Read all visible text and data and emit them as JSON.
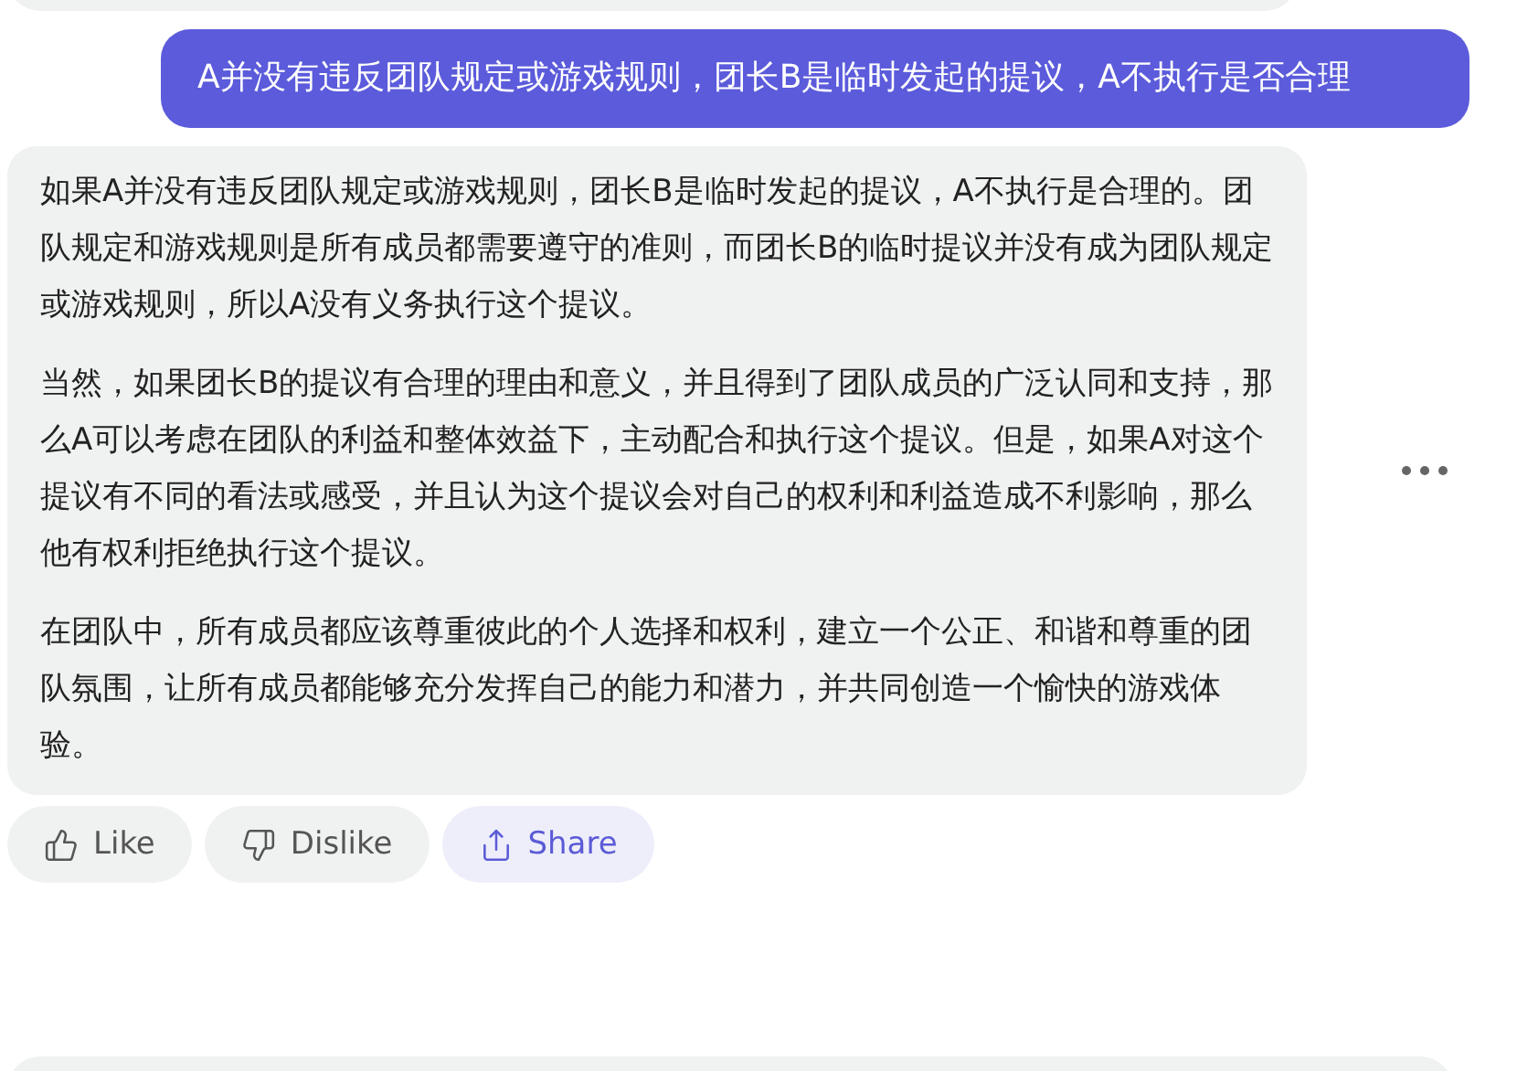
{
  "question": "A并没有违反团队规定或游戏规则，团长B是临时发起的提议，A不执行是否合理",
  "answer": {
    "paragraphs": [
      "如果A并没有违反团队规定或游戏规则，团长B是临时发起的提议，A不执行是合理的。团队规定和游戏规则是所有成员都需要遵守的准则，而团长B的临时提议并没有成为团队规定或游戏规则，所以A没有义务执行这个提议。",
      "当然，如果团长B的提议有合理的理由和意义，并且得到了团队成员的广泛认同和支持，那么A可以考虑在团队的利益和整体效益下，主动配合和执行这个提议。但是，如果A对这个提议有不同的看法或感受，并且认为这个提议会对自己的权利和利益造成不利影响，那么他有权利拒绝执行这个提议。",
      "在团队中，所有成员都应该尊重彼此的个人选择和权利，建立一个公正、和谐和尊重的团队氛围，让所有成员都能够充分发挥自己的能力和潜力，并共同创造一个愉快的游戏体验。"
    ]
  },
  "actions": [
    {
      "kind": "like",
      "label": "Like",
      "selected": false
    },
    {
      "kind": "dislike",
      "label": "Dislike",
      "selected": false
    },
    {
      "kind": "share",
      "label": "Share",
      "selected": true
    }
  ]
}
